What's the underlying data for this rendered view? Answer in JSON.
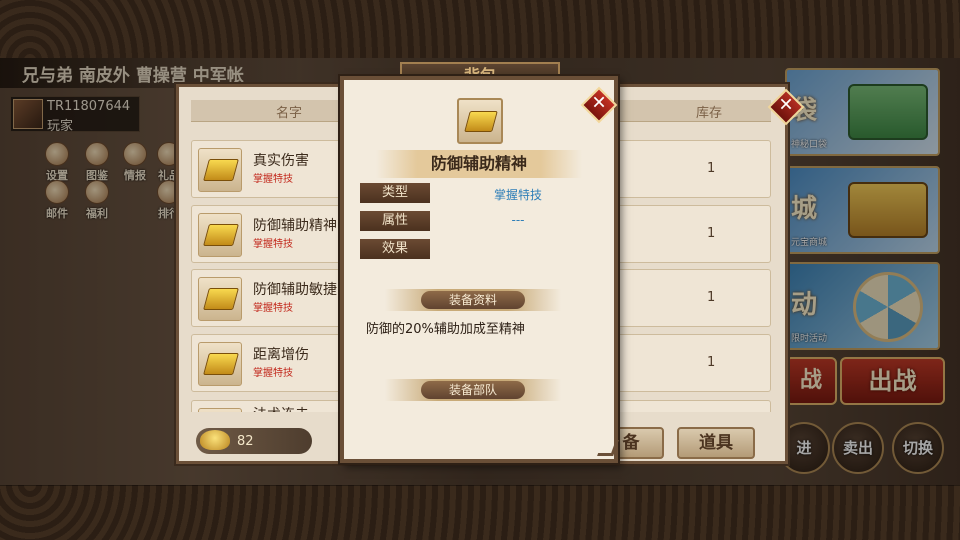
{
  "scene": {
    "title": "兄与弟 南皮外 曹操营 中军帐",
    "player": {
      "id": "TR11807644",
      "role": "玩家"
    },
    "side_icons": [
      {
        "label": "设置"
      },
      {
        "label": "图鉴"
      },
      {
        "label": "情报"
      },
      {
        "label": "礼品"
      },
      {
        "label": "邮件"
      },
      {
        "label": "福利"
      },
      {
        "label": "排行"
      }
    ],
    "promos": [
      {
        "caption": "神秘口袋",
        "big": "袋"
      },
      {
        "caption": "元宝商城",
        "big": "城"
      },
      {
        "caption": "限时活动",
        "big": "动"
      }
    ],
    "battle_button": "出战",
    "battle_button_small": "战",
    "round_buttons": [
      "进",
      "卖出",
      "切换"
    ]
  },
  "bag": {
    "title": "背包",
    "col_name": "名字",
    "col_stock": "库存",
    "items": [
      {
        "name": "真实伤害",
        "sub": "掌握特技",
        "stock": "1"
      },
      {
        "name": "防御辅助精神",
        "sub": "掌握特技",
        "stock": "1"
      },
      {
        "name": "防御辅助敏捷",
        "sub": "掌握特技",
        "stock": "1"
      },
      {
        "name": "距离增伤",
        "sub": "掌握特技",
        "stock": "1"
      },
      {
        "name": "法术连击",
        "sub": "",
        "stock": ""
      }
    ],
    "gold": "82",
    "tab_equip": "备",
    "tab_items": "道具"
  },
  "detail": {
    "title": "防御辅助精神",
    "attributes": [
      {
        "label": "类型",
        "value": "掌握特技"
      },
      {
        "label": "属性",
        "value": "---"
      },
      {
        "label": "效果",
        "value": ""
      }
    ],
    "section_info": "装备资料",
    "description": "防御的20%辅助加成至精神",
    "section_troops": "装备部队"
  },
  "colors": {
    "accent_red": "#c2281c",
    "value_blue": "#2f7fb8",
    "panel_bg": "#e7dccb",
    "frame_brown": "#6a4f37"
  }
}
